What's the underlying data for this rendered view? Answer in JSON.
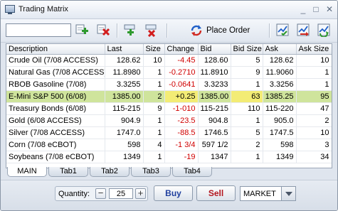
{
  "window": {
    "title": "Trading Matrix",
    "minimize_glyph": "_",
    "restore_glyph": "□",
    "close_glyph": "✕"
  },
  "toolbar": {
    "symbol_value": "",
    "place_order_label": "Place Order",
    "icons": [
      "add-icon",
      "delete-icon",
      "add-row-icon",
      "remove-row-icon",
      "refresh-icon",
      "chart-check-icon",
      "chart-swap-icon",
      "chart-exchange-icon"
    ]
  },
  "grid": {
    "columns": [
      "Description",
      "Last",
      "Size",
      "Change",
      "Bid",
      "Bid Size",
      "Ask",
      "Ask Size"
    ],
    "rows": [
      {
        "description": "Crude Oil (7/08 ACCESS)",
        "last": "128.62",
        "size": "10",
        "change": "-4.45",
        "bid": "128.60",
        "bid_size": "5",
        "ask": "128.62",
        "ask_size": "10",
        "direction": "down"
      },
      {
        "description": "Natural Gas (7/08 ACCESS)",
        "last": "11.8980",
        "size": "1",
        "change": "-0.2710",
        "bid": "11.8910",
        "bid_size": "9",
        "ask": "11.9060",
        "ask_size": "1",
        "direction": "down"
      },
      {
        "description": "RBOB Gasoline (7/08)",
        "last": "3.3255",
        "size": "1",
        "change": "-0.0641",
        "bid": "3.3233",
        "bid_size": "1",
        "ask": "3.3256",
        "ask_size": "1",
        "direction": "down"
      },
      {
        "description": "E-Mini S&P 500 (6/08)",
        "last": "1385.00",
        "size": "2",
        "change": "+0.25",
        "bid": "1385.00",
        "bid_size": "63",
        "ask": "1385.25",
        "ask_size": "95",
        "direction": "up"
      },
      {
        "description": "Treasury Bonds (6/08)",
        "last": "115-215",
        "size": "9",
        "change": "-1-010",
        "bid": "115-215",
        "bid_size": "110",
        "ask": "115-220",
        "ask_size": "47",
        "direction": "down"
      },
      {
        "description": "Gold (6/08 ACCESS)",
        "last": "904.9",
        "size": "1",
        "change": "-23.5",
        "bid": "904.8",
        "bid_size": "1",
        "ask": "905.0",
        "ask_size": "2",
        "direction": "down"
      },
      {
        "description": "Silver (7/08 ACCESS)",
        "last": "1747.0",
        "size": "1",
        "change": "-88.5",
        "bid": "1746.5",
        "bid_size": "5",
        "ask": "1747.5",
        "ask_size": "10",
        "direction": "down"
      },
      {
        "description": "Corn (7/08 eCBOT)",
        "last": "598",
        "size": "4",
        "change": "-1 3/4",
        "bid": "597 1/2",
        "bid_size": "2",
        "ask": "598",
        "ask_size": "3",
        "direction": "down"
      },
      {
        "description": "Soybeans (7/08 eCBOT)",
        "last": "1349",
        "size": "1",
        "change": "-19",
        "bid": "1347",
        "bid_size": "1",
        "ask": "1349",
        "ask_size": "34",
        "direction": "down"
      }
    ],
    "selected_row": 3,
    "colors": {
      "negative": "#d00000",
      "selected_row": "#cfe49c",
      "highlight_cell": "#f3ec75"
    }
  },
  "tabs": [
    "MAIN",
    "Tab1",
    "Tab2",
    "Tab3",
    "Tab4"
  ],
  "active_tab": 0,
  "footer": {
    "quantity_label": "Quantity:",
    "quantity_value": "25",
    "minus_glyph": "−",
    "plus_glyph": "+",
    "buy_label": "Buy",
    "sell_label": "Sell",
    "order_type": "MARKET",
    "colors": {
      "buy": "#1f3f9e",
      "sell": "#b3171f"
    }
  }
}
